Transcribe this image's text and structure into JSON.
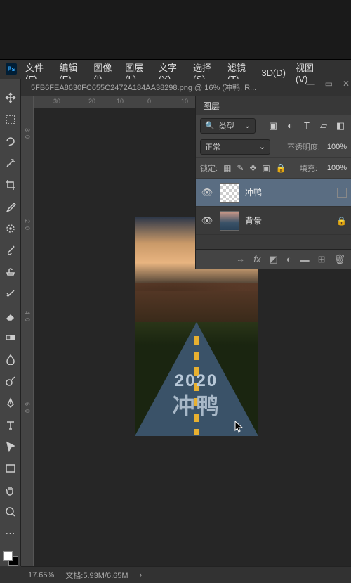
{
  "app_icon": "Ps",
  "menu": {
    "file": "文件(F)",
    "edit": "编辑(E)",
    "image": "图像(I)",
    "layer": "图层(L)",
    "type": "文字(Y)",
    "select": "选择(S)",
    "filter": "滤镜(T)",
    "threeD": "3D(D)",
    "view": "视图(V)"
  },
  "doc_tab": "5FB6FEA8630FC655C2472A184AA38298.png @ 16% (冲鸭, R...",
  "rulers_h": [
    {
      "p": 28,
      "v": "30"
    },
    {
      "p": 78,
      "v": "20"
    },
    {
      "p": 118,
      "v": "10"
    },
    {
      "p": 162,
      "v": "0"
    },
    {
      "p": 210,
      "v": "10"
    }
  ],
  "rulers_v": [
    {
      "p": 28,
      "v": "3"
    },
    {
      "p": 38,
      "v": "0"
    },
    {
      "p": 158,
      "v": "2"
    },
    {
      "p": 168,
      "v": "0"
    },
    {
      "p": 288,
      "v": "4"
    },
    {
      "p": 298,
      "v": "0"
    },
    {
      "p": 418,
      "v": "6"
    },
    {
      "p": 428,
      "v": "0"
    }
  ],
  "artwork": {
    "year": "2020",
    "text": "冲鸭"
  },
  "layers_panel": {
    "tab": "图层",
    "filter_label": "类型",
    "blend_mode": "正常",
    "opacity_label": "不透明度:",
    "opacity_value": "100%",
    "lock_label": "锁定:",
    "fill_label": "填充:",
    "fill_value": "100%",
    "items": [
      {
        "name": "冲鸭",
        "selected": true,
        "thumb": "checker",
        "locked": false
      },
      {
        "name": "背景",
        "selected": false,
        "thumb": "img",
        "locked": true
      }
    ]
  },
  "status": {
    "zoom": "17.65%",
    "doc": "文档:5.93M/6.65M"
  }
}
